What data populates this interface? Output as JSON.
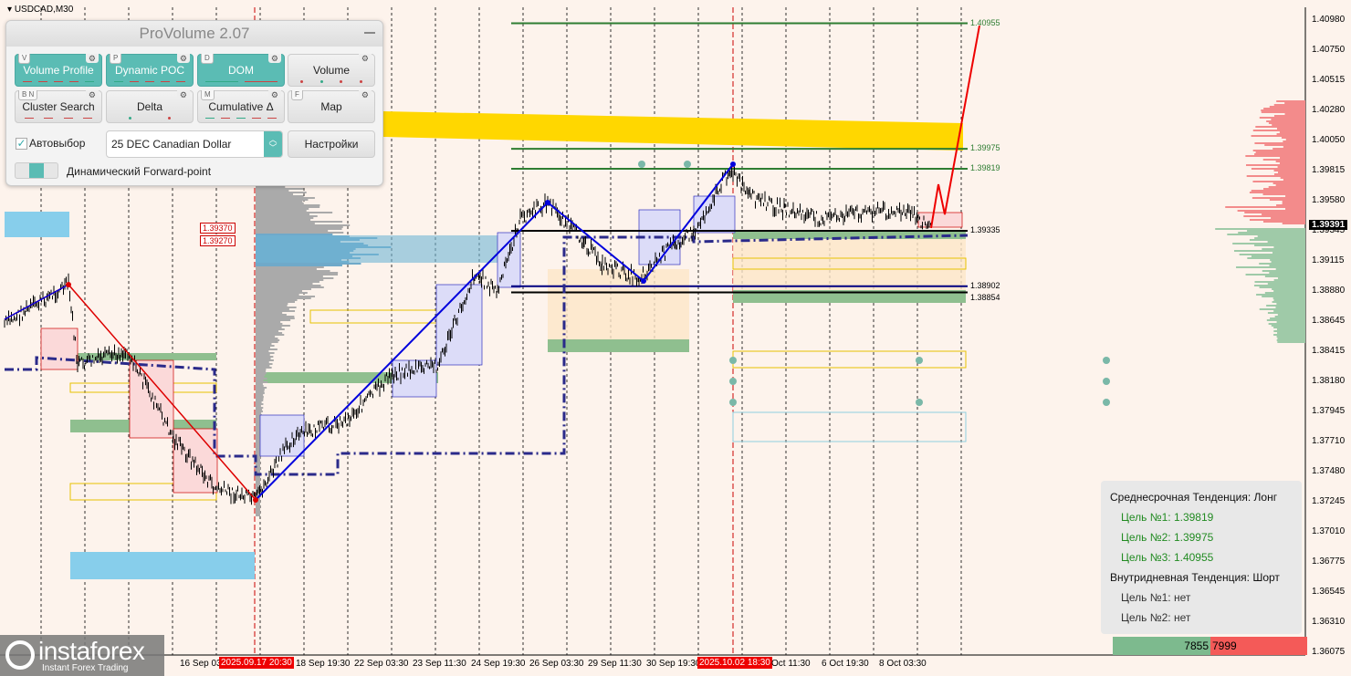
{
  "chart": {
    "symbol": "USDCAD,M30",
    "current_price": "1.39391",
    "price_axis": [
      "1.40980",
      "1.40750",
      "1.40515",
      "1.40280",
      "1.40050",
      "1.39815",
      "1.39580",
      "1.39345",
      "1.39115",
      "1.38880",
      "1.38645",
      "1.38415",
      "1.38180",
      "1.37945",
      "1.37710",
      "1.37480",
      "1.37245",
      "1.37010",
      "1.36775",
      "1.36545",
      "1.36310",
      "1.36075"
    ],
    "time_axis": [
      {
        "label": "16 Sep 03",
        "highlight": false
      },
      {
        "label": "2025.09.17 20:30",
        "highlight": true
      },
      {
        "label": "18 Sep 19:30",
        "highlight": false
      },
      {
        "label": "22 Sep 03:30",
        "highlight": false
      },
      {
        "label": "23 Sep 11:30",
        "highlight": false
      },
      {
        "label": "24 Sep 19:30",
        "highlight": false
      },
      {
        "label": "26 Sep 03:30",
        "highlight": false
      },
      {
        "label": "29 Sep 11:30",
        "highlight": false
      },
      {
        "label": "30 Sep 19:30",
        "highlight": false
      },
      {
        "label": "2025.10.02 18:30",
        "highlight": true
      },
      {
        "label": "Oct 11:30",
        "highlight": false
      },
      {
        "label": "6 Oct 19:30",
        "highlight": false
      },
      {
        "label": "8 Oct 03:30",
        "highlight": false
      }
    ],
    "levels": [
      {
        "label": "1.40955",
        "price": 1.40955,
        "color": "#2e7d32"
      },
      {
        "label": "1.39975",
        "price": 1.39975,
        "color": "#2e7d32"
      },
      {
        "label": "1.39819",
        "price": 1.39819,
        "color": "#2e7d32"
      },
      {
        "label": "1.39335",
        "price": 1.39335,
        "color": "#000000"
      },
      {
        "label": "1.38902",
        "price": 1.38902,
        "color": "#000080"
      },
      {
        "label": "1.38854",
        "price": 1.38854,
        "color": "#000000"
      }
    ],
    "left_levels": [
      "1.39370",
      "1.39270"
    ],
    "price_path": [
      1.38609,
      1.38915,
      1.38289,
      1.38396,
      1.37719,
      1.37327,
      1.37235,
      1.37719,
      1.37862,
      1.38218,
      1.38289,
      1.39001,
      1.38858,
      1.39428,
      1.39556,
      1.3925,
      1.39072,
      1.38965,
      1.3925,
      1.39321,
      1.39819,
      1.39606,
      1.39499,
      1.39428,
      1.39499,
      1.39463,
      1.39357
    ],
    "forecast_path": [
      1.39357,
      1.39698,
      1.39463,
      1.40937
    ],
    "colors": {
      "bull": "#2e7d32",
      "bear": "#e00000",
      "accent": "#5bbcb4",
      "zone_yellow": "#ffd700",
      "zone_blue": "#87ceeb"
    }
  },
  "panel": {
    "title": "ProVolume 2.07",
    "buttons": [
      {
        "key": "V",
        "label": "Volume Profile",
        "active": true
      },
      {
        "key": "P",
        "label": "Dynamic POC",
        "active": true
      },
      {
        "key": "D",
        "label": "DOM",
        "active": true
      },
      {
        "key": "",
        "label": "Volume",
        "active": false
      },
      {
        "key": "B  N",
        "label": "Cluster Search",
        "active": false
      },
      {
        "key": "",
        "label": "Delta",
        "active": false
      },
      {
        "key": "M",
        "label": "Cumulative Δ",
        "active": false
      },
      {
        "key": "F",
        "label": "Map",
        "active": false
      }
    ],
    "autoselect_label": "Автовыбор",
    "instrument": "25 DEC Canadian Dollar",
    "settings_label": "Настройки",
    "forward_point_label": "Динамический Forward-point"
  },
  "info": {
    "medium_trend": "Среднесрочная Тенденция: Лонг",
    "medium_targets": [
      "Цель №1: 1.39819",
      "Цель №2: 1.39975",
      "Цель №3: 1.40955"
    ],
    "intraday_trend": "Внутридневная Тенденция: Шорт",
    "intraday_targets": [
      "Цель №1: нет",
      "Цель №2: нет"
    ]
  },
  "dom": {
    "buy": "7855",
    "sell": "7999"
  },
  "logo": {
    "name": "instaforex",
    "tagline": "Instant Forex Trading"
  }
}
